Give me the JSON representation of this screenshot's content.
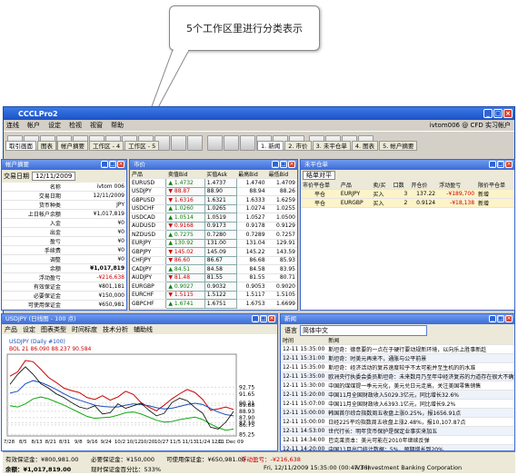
{
  "callout": "5个工作区里进行分类表示",
  "window": {
    "title": "CCCLPro2"
  },
  "menu": [
    "连线",
    "帐户",
    "设定",
    "检视",
    "视窗",
    "帮助"
  ],
  "menu_right": "ivtom006 @ CFD 实习帐户",
  "workspaces": [
    "取引画面",
    "图表",
    "帐户摘要",
    "工作区 - 4",
    "工作区 - 5"
  ],
  "right_tabs": [
    "1. 新闻",
    "2. 市价",
    "3. 未平仓单",
    "4. 图表",
    "5. 帐户摘要"
  ],
  "account": {
    "title": "帐户摘要",
    "date_label": "交易日期",
    "date": "12/11/2009",
    "rows": [
      [
        "名称",
        "ivtom 006"
      ],
      [
        "交易日期",
        "12/11/2009"
      ],
      [
        "货币种类",
        "JPY"
      ],
      [
        "上日帐户余额",
        "¥1,017,819"
      ],
      [
        "入金",
        "¥0"
      ],
      [
        "出金",
        "¥0"
      ],
      [
        "盈亏",
        "¥0"
      ],
      [
        "手续费",
        "¥0"
      ],
      [
        "调整",
        "¥0"
      ],
      [
        "余额",
        "¥1,017,819"
      ],
      [
        "浮动盈亏",
        "-¥216,638"
      ],
      [
        "有效保证金",
        "¥801,181"
      ],
      [
        "必要保证金",
        "¥150,000"
      ],
      [
        "可使用保证金",
        "¥650,981"
      ]
    ]
  },
  "market": {
    "title": "市价",
    "headers": [
      "产品",
      "卖值Bid",
      "买值Ask",
      "最高Bid",
      "最低Bid"
    ],
    "rows": [
      [
        "EURUSD",
        "up",
        "1.4732",
        "1.4737",
        "1.4740",
        "1.4709"
      ],
      [
        "USDJPY",
        "dn",
        "88.87",
        "88.90",
        "88.94",
        "88.26"
      ],
      [
        "GBPUSD",
        "dn",
        "1.6316",
        "1.6321",
        "1.6333",
        "1.6259"
      ],
      [
        "USDCHF",
        "up",
        "1.0260",
        "1.0265",
        "1.0274",
        "1.0255"
      ],
      [
        "USDCAD",
        "up",
        "1.0514",
        "1.0519",
        "1.0527",
        "1.0500"
      ],
      [
        "AUDUSD",
        "dn",
        "0.9168",
        "0.9173",
        "0.9178",
        "0.9129"
      ],
      [
        "NZDUSD",
        "up",
        "0.7275",
        "0.7280",
        "0.7289",
        "0.7257"
      ],
      [
        "EURJPY",
        "up",
        "130.92",
        "131.00",
        "131.04",
        "129.91"
      ],
      [
        "GBPJPY",
        "dn",
        "145.02",
        "145.09",
        "145.22",
        "143.59"
      ],
      [
        "CHFJPY",
        "dn",
        "86.60",
        "86.67",
        "86.68",
        "85.93"
      ],
      [
        "CADJPY",
        "up",
        "84.51",
        "84.58",
        "84.58",
        "83.95"
      ],
      [
        "AUDJPY",
        "dn",
        "81.48",
        "81.55",
        "81.55",
        "80.71"
      ],
      [
        "EURGBP",
        "up",
        "0.9027",
        "0.9032",
        "0.9053",
        "0.9020"
      ],
      [
        "EURCHF",
        "dn",
        "1.5115",
        "1.5122",
        "1.5117",
        "1.5105"
      ],
      [
        "GBPCHF",
        "up",
        "1.6741",
        "1.6751",
        "1.6753",
        "1.6699"
      ]
    ]
  },
  "positions": {
    "title": "未平仓单",
    "close_btn": "结单对平",
    "headers": [
      "市价平仓单",
      "产品",
      "卖/买",
      "口数",
      "开仓价",
      "浮动盈亏",
      "限价平仓单"
    ],
    "rows": [
      [
        "平仓",
        "EURJPY",
        "买入",
        "3",
        "137.22",
        "-¥189,700",
        "新增"
      ],
      [
        "平仓",
        "EURGBP",
        "买入",
        "2",
        "0.9124",
        "-¥18,138",
        "新增"
      ]
    ]
  },
  "chart": {
    "title": "USDJPY (日线图 - 100 点)",
    "menu": [
      "产品",
      "设定",
      "图表类型",
      "时间标度",
      "技术分析",
      "辅助线"
    ],
    "label": "USDJPY (Daily #100)",
    "bol": "BOL 21 86.090 88.237 90.584",
    "yticks": [
      "92.75",
      "91.65",
      "90.21",
      "89.88",
      "88.93",
      "87.90",
      "87.10",
      "86.75",
      "85.25"
    ],
    "xticks": [
      "7/28",
      "8/5",
      "8/13",
      "8/21",
      "8/31",
      "9/8",
      "9/16",
      "9/24",
      "10/2",
      "10/12",
      "10/20",
      "10/27",
      "11/5",
      "11/13",
      "11/24",
      "12/1",
      "11 Dec 09"
    ],
    "chart_data": {
      "type": "line",
      "series": [
        {
          "values": [
            94.5,
            95.2,
            97.0,
            96.8,
            95.6,
            94.3,
            93.5,
            92.6,
            92.2,
            91.9,
            91.1,
            90.8,
            91.4,
            90.7,
            91.2,
            92.1,
            91.6,
            90.3,
            89.6,
            89.0,
            89.9,
            90.9,
            91.7,
            92.4,
            91.9,
            90.8,
            89.1,
            89.3,
            89.6,
            89.2
          ]
        },
        {
          "values": [
            91.8,
            92.1,
            93.3,
            93.8,
            93.5,
            93.0,
            92.4,
            91.7,
            91.1,
            90.7,
            90.3,
            89.9,
            89.7,
            89.6,
            89.6,
            89.9,
            90.1,
            90.0,
            89.8,
            89.5,
            89.3,
            89.4,
            89.7,
            90.0,
            90.2,
            90.0,
            89.4,
            88.8,
            88.4,
            88.2
          ]
        },
        {
          "values": [
            89.8,
            89.6,
            90.1,
            90.9,
            91.2,
            90.9,
            90.4,
            89.9,
            89.3,
            88.7,
            88.1,
            87.8,
            87.9,
            88.0,
            88.3,
            88.7,
            88.8,
            88.5,
            88.0,
            87.5,
            87.2,
            87.3,
            87.6,
            87.8,
            88.0,
            87.6,
            86.9,
            86.3,
            85.9,
            86.1
          ]
        },
        {
          "values": [
            93.2,
            94.8,
            96.0,
            94.8,
            93.3,
            92.6,
            91.7,
            91.1,
            90.3,
            89.6,
            89.3,
            89.8,
            88.5,
            88.7,
            90.1,
            89.4,
            89.8,
            90.2,
            89.1,
            88.2,
            88.6,
            90.3,
            91.0,
            90.6,
            89.5,
            88.6,
            86.4,
            86.1,
            87.2,
            88.9
          ]
        }
      ],
      "ylim": [
        85,
        98
      ]
    }
  },
  "news": {
    "title": "新闻",
    "lang": "简体中文",
    "headers": [
      "时间",
      "新闻"
    ],
    "rows": [
      [
        "12-11 15:35:00",
        "斯坦奇：德意要的一点在于硬行要动规新环境，以向乐上胜事新趁"
      ],
      [
        "12-11 15:31:00",
        "斯坦奇：时美元再来不，通胀与公平前景"
      ],
      [
        "12-11 15:35:00",
        "斯坦奇：经济活动的复苏速度较乎不太可能并至生机的的水准"
      ],
      [
        "12-11 15:35:00",
        "欧洲央行执委会委员斯坦奇：未来数月乃至年中经济复苏的力道存在很大不确定性"
      ],
      [
        "12-11 15:30:00",
        "中国的煤煤提一季元元化，美元兑日元走高，关注美国零售销售"
      ],
      [
        "12-11 15:20:00",
        "中国11月全国财政收入5029.3亿元，同比增长32.6%"
      ],
      [
        "12-11 15:07:00",
        "中国11月全国财政收入6393.1亿元，同比增长9.2%"
      ],
      [
        "12-11 15:00:00",
        "韩国首尔综合指数周五收盘上涨0.25%，报1656.91点"
      ],
      [
        "12-11 15:00:00",
        "日经225平均指数周五收盘上涨2.48%，报10,107.87点"
      ],
      [
        "12-11 14:53:00",
        "世代行长：明年货币保护是保定业事实来加五"
      ],
      [
        "12-11 14:34:00",
        "巴克莱资本：美元可能在2010年继续反弹"
      ],
      [
        "12-11 14:20:00",
        "中国11月出口统计数据：5%，预期增长到20%"
      ]
    ]
  },
  "status": {
    "eff_margin": "有效保证金：¥800,981.00",
    "nec_margin": "必要保证金：¥150,000",
    "usable": "可使用保证金：¥650,981.00",
    "float": "浮动盈亏：-¥216,638",
    "balance": "余额：¥1,017,819.00",
    "ratio": "现时保证金百分比：533%",
    "datetime": "Fri, 12/11/2009 15:35:00  (00:47:36)",
    "company": "IVT Investment Banking Corporation"
  }
}
